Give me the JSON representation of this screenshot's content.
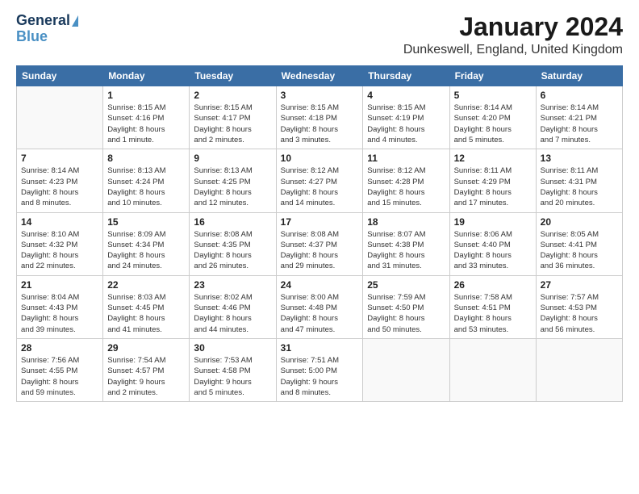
{
  "logo": {
    "line1": "General",
    "line2": "Blue"
  },
  "title": {
    "month": "January 2024",
    "location": "Dunkeswell, England, United Kingdom"
  },
  "weekdays": [
    "Sunday",
    "Monday",
    "Tuesday",
    "Wednesday",
    "Thursday",
    "Friday",
    "Saturday"
  ],
  "weeks": [
    [
      {
        "day": "",
        "sunrise": "",
        "sunset": "",
        "daylight": ""
      },
      {
        "day": "1",
        "sunrise": "Sunrise: 8:15 AM",
        "sunset": "Sunset: 4:16 PM",
        "daylight": "Daylight: 8 hours and 1 minute."
      },
      {
        "day": "2",
        "sunrise": "Sunrise: 8:15 AM",
        "sunset": "Sunset: 4:17 PM",
        "daylight": "Daylight: 8 hours and 2 minutes."
      },
      {
        "day": "3",
        "sunrise": "Sunrise: 8:15 AM",
        "sunset": "Sunset: 4:18 PM",
        "daylight": "Daylight: 8 hours and 3 minutes."
      },
      {
        "day": "4",
        "sunrise": "Sunrise: 8:15 AM",
        "sunset": "Sunset: 4:19 PM",
        "daylight": "Daylight: 8 hours and 4 minutes."
      },
      {
        "day": "5",
        "sunrise": "Sunrise: 8:14 AM",
        "sunset": "Sunset: 4:20 PM",
        "daylight": "Daylight: 8 hours and 5 minutes."
      },
      {
        "day": "6",
        "sunrise": "Sunrise: 8:14 AM",
        "sunset": "Sunset: 4:21 PM",
        "daylight": "Daylight: 8 hours and 7 minutes."
      }
    ],
    [
      {
        "day": "7",
        "sunrise": "Sunrise: 8:14 AM",
        "sunset": "Sunset: 4:23 PM",
        "daylight": "Daylight: 8 hours and 8 minutes."
      },
      {
        "day": "8",
        "sunrise": "Sunrise: 8:13 AM",
        "sunset": "Sunset: 4:24 PM",
        "daylight": "Daylight: 8 hours and 10 minutes."
      },
      {
        "day": "9",
        "sunrise": "Sunrise: 8:13 AM",
        "sunset": "Sunset: 4:25 PM",
        "daylight": "Daylight: 8 hours and 12 minutes."
      },
      {
        "day": "10",
        "sunrise": "Sunrise: 8:12 AM",
        "sunset": "Sunset: 4:27 PM",
        "daylight": "Daylight: 8 hours and 14 minutes."
      },
      {
        "day": "11",
        "sunrise": "Sunrise: 8:12 AM",
        "sunset": "Sunset: 4:28 PM",
        "daylight": "Daylight: 8 hours and 15 minutes."
      },
      {
        "day": "12",
        "sunrise": "Sunrise: 8:11 AM",
        "sunset": "Sunset: 4:29 PM",
        "daylight": "Daylight: 8 hours and 17 minutes."
      },
      {
        "day": "13",
        "sunrise": "Sunrise: 8:11 AM",
        "sunset": "Sunset: 4:31 PM",
        "daylight": "Daylight: 8 hours and 20 minutes."
      }
    ],
    [
      {
        "day": "14",
        "sunrise": "Sunrise: 8:10 AM",
        "sunset": "Sunset: 4:32 PM",
        "daylight": "Daylight: 8 hours and 22 minutes."
      },
      {
        "day": "15",
        "sunrise": "Sunrise: 8:09 AM",
        "sunset": "Sunset: 4:34 PM",
        "daylight": "Daylight: 8 hours and 24 minutes."
      },
      {
        "day": "16",
        "sunrise": "Sunrise: 8:08 AM",
        "sunset": "Sunset: 4:35 PM",
        "daylight": "Daylight: 8 hours and 26 minutes."
      },
      {
        "day": "17",
        "sunrise": "Sunrise: 8:08 AM",
        "sunset": "Sunset: 4:37 PM",
        "daylight": "Daylight: 8 hours and 29 minutes."
      },
      {
        "day": "18",
        "sunrise": "Sunrise: 8:07 AM",
        "sunset": "Sunset: 4:38 PM",
        "daylight": "Daylight: 8 hours and 31 minutes."
      },
      {
        "day": "19",
        "sunrise": "Sunrise: 8:06 AM",
        "sunset": "Sunset: 4:40 PM",
        "daylight": "Daylight: 8 hours and 33 minutes."
      },
      {
        "day": "20",
        "sunrise": "Sunrise: 8:05 AM",
        "sunset": "Sunset: 4:41 PM",
        "daylight": "Daylight: 8 hours and 36 minutes."
      }
    ],
    [
      {
        "day": "21",
        "sunrise": "Sunrise: 8:04 AM",
        "sunset": "Sunset: 4:43 PM",
        "daylight": "Daylight: 8 hours and 39 minutes."
      },
      {
        "day": "22",
        "sunrise": "Sunrise: 8:03 AM",
        "sunset": "Sunset: 4:45 PM",
        "daylight": "Daylight: 8 hours and 41 minutes."
      },
      {
        "day": "23",
        "sunrise": "Sunrise: 8:02 AM",
        "sunset": "Sunset: 4:46 PM",
        "daylight": "Daylight: 8 hours and 44 minutes."
      },
      {
        "day": "24",
        "sunrise": "Sunrise: 8:00 AM",
        "sunset": "Sunset: 4:48 PM",
        "daylight": "Daylight: 8 hours and 47 minutes."
      },
      {
        "day": "25",
        "sunrise": "Sunrise: 7:59 AM",
        "sunset": "Sunset: 4:50 PM",
        "daylight": "Daylight: 8 hours and 50 minutes."
      },
      {
        "day": "26",
        "sunrise": "Sunrise: 7:58 AM",
        "sunset": "Sunset: 4:51 PM",
        "daylight": "Daylight: 8 hours and 53 minutes."
      },
      {
        "day": "27",
        "sunrise": "Sunrise: 7:57 AM",
        "sunset": "Sunset: 4:53 PM",
        "daylight": "Daylight: 8 hours and 56 minutes."
      }
    ],
    [
      {
        "day": "28",
        "sunrise": "Sunrise: 7:56 AM",
        "sunset": "Sunset: 4:55 PM",
        "daylight": "Daylight: 8 hours and 59 minutes."
      },
      {
        "day": "29",
        "sunrise": "Sunrise: 7:54 AM",
        "sunset": "Sunset: 4:57 PM",
        "daylight": "Daylight: 9 hours and 2 minutes."
      },
      {
        "day": "30",
        "sunrise": "Sunrise: 7:53 AM",
        "sunset": "Sunset: 4:58 PM",
        "daylight": "Daylight: 9 hours and 5 minutes."
      },
      {
        "day": "31",
        "sunrise": "Sunrise: 7:51 AM",
        "sunset": "Sunset: 5:00 PM",
        "daylight": "Daylight: 9 hours and 8 minutes."
      },
      {
        "day": "",
        "sunrise": "",
        "sunset": "",
        "daylight": ""
      },
      {
        "day": "",
        "sunrise": "",
        "sunset": "",
        "daylight": ""
      },
      {
        "day": "",
        "sunrise": "",
        "sunset": "",
        "daylight": ""
      }
    ]
  ]
}
